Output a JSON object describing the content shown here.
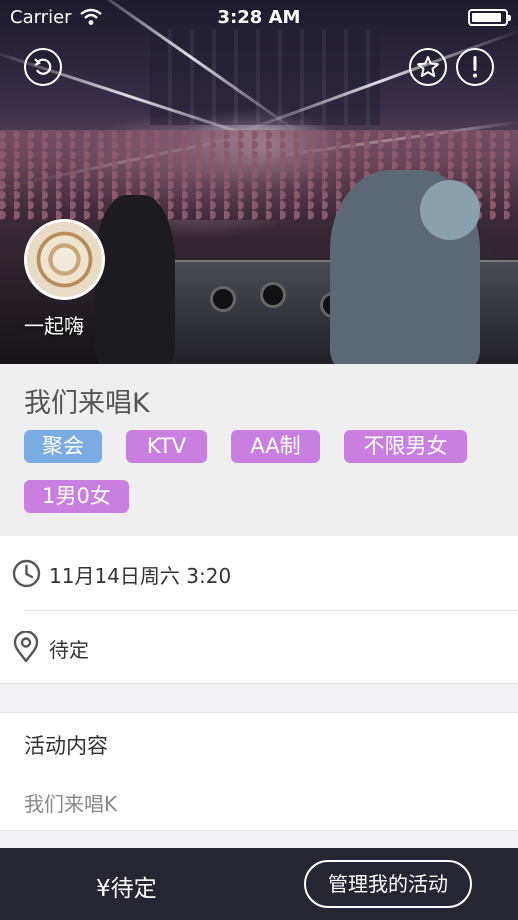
{
  "status_bar": {
    "carrier": "Carrier",
    "time": "3:28 AM",
    "battery_level": 0.9
  },
  "hero": {
    "back_icon": "refresh-back-icon",
    "favorite_icon": "star-icon",
    "report_icon": "exclamation-icon",
    "organizer_name": "一起嗨"
  },
  "event": {
    "title": "我们来唱K",
    "tags": [
      {
        "label": "聚会",
        "color": "#7aabe2"
      },
      {
        "label": "KTV",
        "color": "#c97fe0"
      },
      {
        "label": "AA制",
        "color": "#c97fe0"
      },
      {
        "label": "不限男女",
        "color": "#c97fe0"
      },
      {
        "label": "1男0女",
        "color": "#c97fe0"
      }
    ]
  },
  "details": {
    "time_icon": "clock-icon",
    "time": "11月14日周六 3:20",
    "location_icon": "location-pin-icon",
    "location": "待定"
  },
  "content": {
    "heading": "活动内容",
    "body": "我们来唱K"
  },
  "bottom_bar": {
    "price": "¥待定",
    "manage_button": "管理我的活动",
    "background": "#262633"
  }
}
